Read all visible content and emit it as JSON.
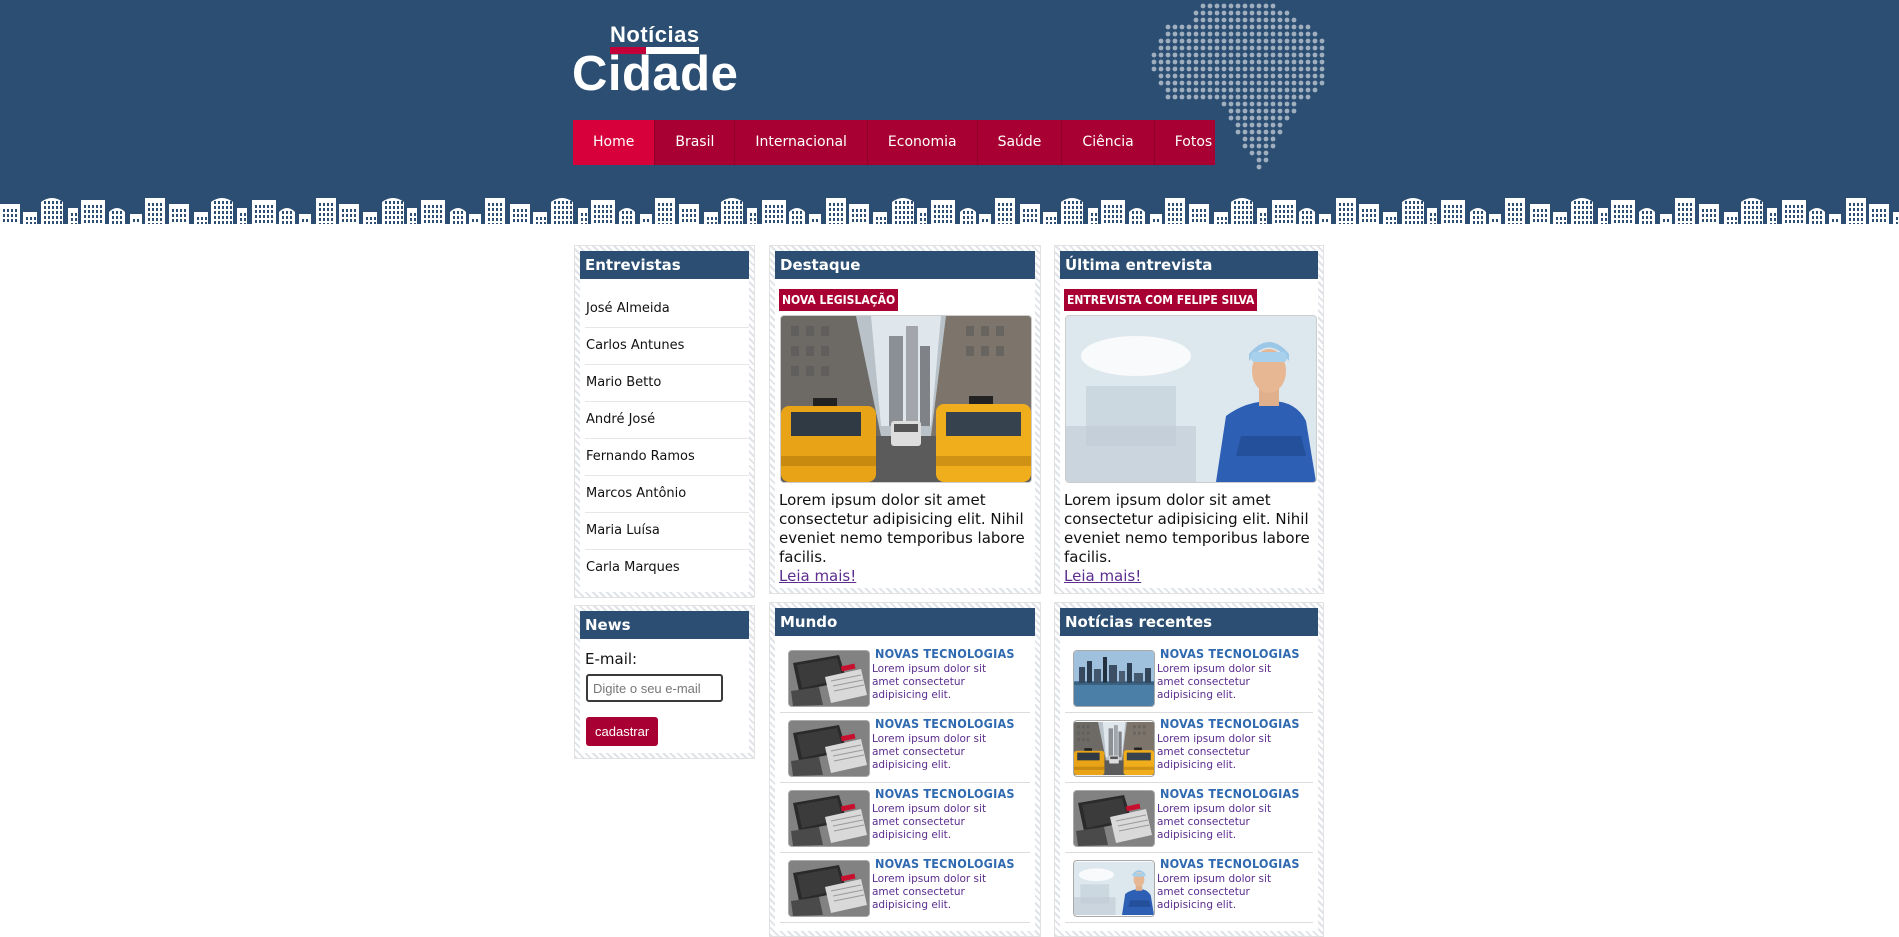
{
  "header": {
    "logo_top": "Notícias",
    "logo_main": "Cidade"
  },
  "nav": {
    "items": [
      "Home",
      "Brasil",
      "Internacional",
      "Economia",
      "Saúde",
      "Ciência",
      "Fotos"
    ],
    "active": "Home"
  },
  "colors": {
    "header_bg": "#2b4e72",
    "nav_bg": "#a90033",
    "nav_active": "#d8003a",
    "accent_red": "#a90033",
    "link_blue": "#2f6ab0",
    "link_purple": "#5b2d8e"
  },
  "interviews": {
    "title": "Entrevistas",
    "items": [
      "José Almeida",
      "Carlos Antunes",
      "Mario Betto",
      "André José",
      "Fernando Ramos",
      "Marcos Antônio",
      "Maria Luísa",
      "Carla Marques"
    ]
  },
  "featured": {
    "title": "Destaque",
    "tag": "NOVA LEGISLAÇÃO",
    "image": "city-street-taxis-photo",
    "text": "Lorem ipsum dolor sit amet consectetur adipisicing elit. Nihil eveniet nemo temporibus labore facilis.",
    "link": "Leia mais!"
  },
  "last_interview": {
    "title": "Última entrevista",
    "tag": "ENTREVISTA COM FELIPE SILVA",
    "image": "surgeon-photo",
    "text": "Lorem ipsum dolor sit amet consectetur adipisicing elit. Nihil eveniet nemo temporibus labore facilis.",
    "link": "Leia mais!"
  },
  "newsletter": {
    "title": "News",
    "label": "E-mail:",
    "placeholder": "Digite o seu e-mail",
    "button": "cadastrar"
  },
  "world": {
    "title": "Mundo",
    "items": [
      {
        "title": "NOVAS TECNOLOGIAS",
        "text": "Lorem ipsum dolor sit amet consectetur adipisicing elit.",
        "image": "laptop-notebook-thumb"
      },
      {
        "title": "NOVAS TECNOLOGIAS",
        "text": "Lorem ipsum dolor sit amet consectetur adipisicing elit.",
        "image": "laptop-notebook-thumb"
      },
      {
        "title": "NOVAS TECNOLOGIAS",
        "text": "Lorem ipsum dolor sit amet consectetur adipisicing elit.",
        "image": "laptop-notebook-thumb"
      },
      {
        "title": "NOVAS TECNOLOGIAS",
        "text": "Lorem ipsum dolor sit amet consectetur adipisicing elit.",
        "image": "laptop-notebook-thumb"
      }
    ]
  },
  "recent": {
    "title": "Notícias recentes",
    "items": [
      {
        "title": "NOVAS TECNOLOGIAS",
        "text": "Lorem ipsum dolor sit amet consectetur adipisicing elit.",
        "image": "city-skyline-thumb"
      },
      {
        "title": "NOVAS TECNOLOGIAS",
        "text": "Lorem ipsum dolor sit amet consectetur adipisicing elit.",
        "image": "taxi-street-thumb"
      },
      {
        "title": "NOVAS TECNOLOGIAS",
        "text": "Lorem ipsum dolor sit amet consectetur adipisicing elit.",
        "image": "laptop-notebook-thumb"
      },
      {
        "title": "NOVAS TECNOLOGIAS",
        "text": "Lorem ipsum dolor sit amet consectetur adipisicing elit.",
        "image": "surgeon-thumb"
      }
    ]
  }
}
